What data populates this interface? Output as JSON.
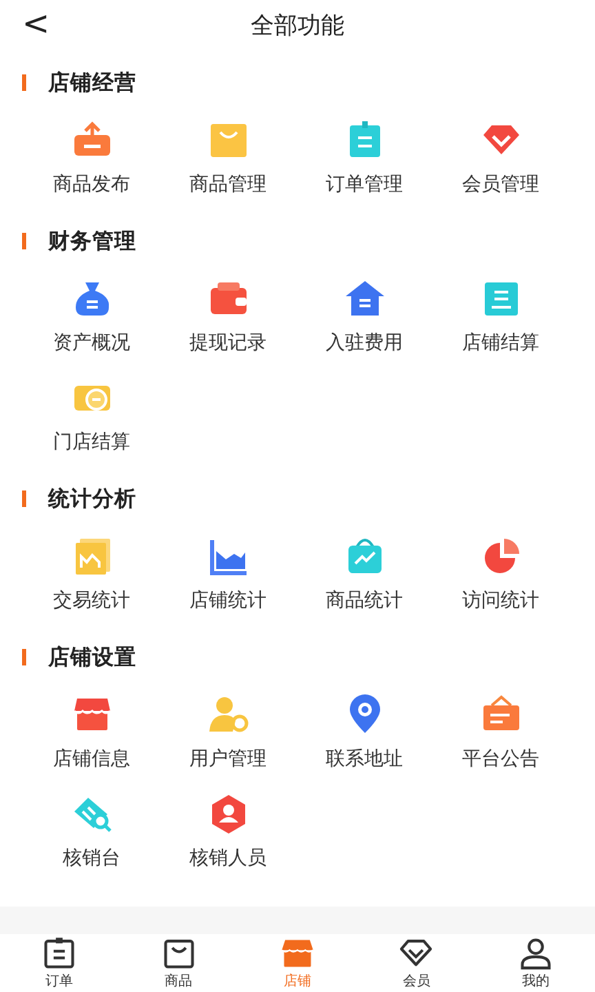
{
  "header": {
    "back": "<",
    "title": "全部功能"
  },
  "sections": [
    {
      "title": "店铺经营",
      "items": [
        "商品发布",
        "商品管理",
        "订单管理",
        "会员管理"
      ]
    },
    {
      "title": "财务管理",
      "items": [
        "资产概况",
        "提现记录",
        "入驻费用",
        "店铺结算",
        "门店结算"
      ]
    },
    {
      "title": "统计分析",
      "items": [
        "交易统计",
        "店铺统计",
        "商品统计",
        "访问统计"
      ]
    },
    {
      "title": "店铺设置",
      "items": [
        "店铺信息",
        "用户管理",
        "联系地址",
        "平台公告",
        "核销台",
        "核销人员"
      ]
    }
  ],
  "tabs": [
    {
      "label": "订单",
      "selected": false
    },
    {
      "label": "商品",
      "selected": false
    },
    {
      "label": "店铺",
      "selected": true
    },
    {
      "label": "会员",
      "selected": false
    },
    {
      "label": "我的",
      "selected": false
    }
  ]
}
